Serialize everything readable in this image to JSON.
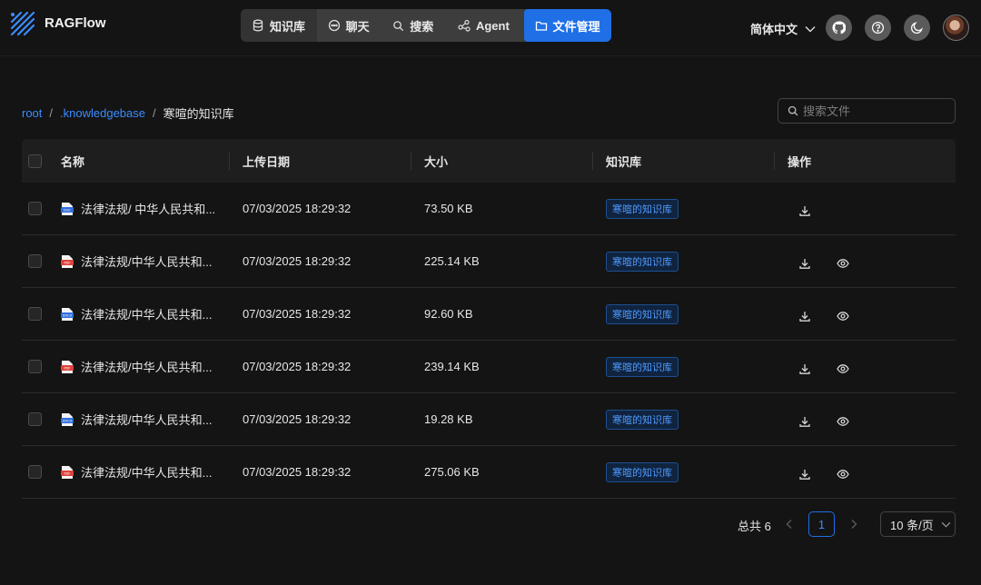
{
  "app": {
    "title": "RAGFlow"
  },
  "nav": [
    {
      "label": "知识库",
      "icon": "database-icon"
    },
    {
      "label": "聊天",
      "icon": "chat-bubble-icon"
    },
    {
      "label": "搜索",
      "icon": "search-icon"
    },
    {
      "label": "Agent",
      "icon": "graph-icon"
    },
    {
      "label": "文件管理",
      "icon": "folder-icon",
      "active": true
    }
  ],
  "header": {
    "language": "简体中文"
  },
  "breadcrumb": {
    "root": "root",
    "parent": ".knowledgebase",
    "current": "寒暄的知识库"
  },
  "search": {
    "placeholder": "搜索文件"
  },
  "table": {
    "headers": {
      "name": "名称",
      "date": "上传日期",
      "size": "大小",
      "kb": "知识库",
      "ops": "操作"
    },
    "rows": [
      {
        "name": "法律法规/ 中华人民共和...",
        "date": "07/03/2025 18:29:32",
        "size": "73.50 KB",
        "kb": "寒暄的知识库",
        "type": "doc",
        "preview": false
      },
      {
        "name": "法律法规/中华人民共和...",
        "date": "07/03/2025 18:29:32",
        "size": "225.14 KB",
        "kb": "寒暄的知识库",
        "type": "pdf",
        "preview": true
      },
      {
        "name": "法律法规/中华人民共和...",
        "date": "07/03/2025 18:29:32",
        "size": "92.60 KB",
        "kb": "寒暄的知识库",
        "type": "docx",
        "preview": true
      },
      {
        "name": "法律法规/中华人民共和...",
        "date": "07/03/2025 18:29:32",
        "size": "239.14 KB",
        "kb": "寒暄的知识库",
        "type": "pdf",
        "preview": true
      },
      {
        "name": "法律法规/中华人民共和...",
        "date": "07/03/2025 18:29:32",
        "size": "19.28 KB",
        "kb": "寒暄的知识库",
        "type": "docx",
        "preview": true
      },
      {
        "name": "法律法规/中华人民共和...",
        "date": "07/03/2025 18:29:32",
        "size": "275.06 KB",
        "kb": "寒暄的知识库",
        "type": "pdf",
        "preview": true
      }
    ]
  },
  "pagination": {
    "total": "总共 6",
    "page": "1",
    "page_size": "10 条/页"
  },
  "colors": {
    "accent": "#1f6fe6",
    "link": "#3b8cff",
    "background": "#141414"
  }
}
